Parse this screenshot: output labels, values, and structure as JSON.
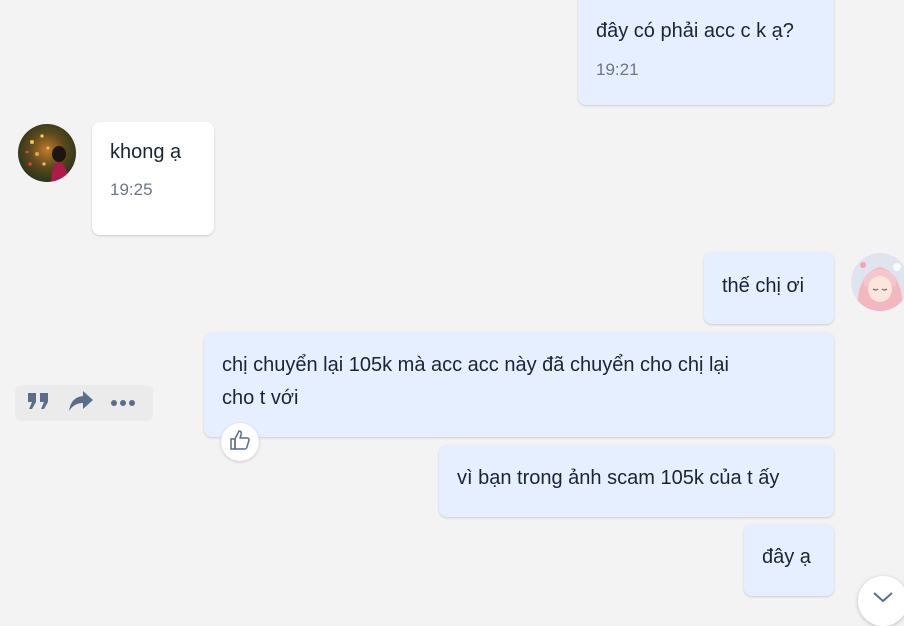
{
  "messages": [
    {
      "id": "m1",
      "direction": "outgoing",
      "text": "đây có phải acc c k ạ?",
      "time": "19:21"
    },
    {
      "id": "m2",
      "direction": "incoming",
      "text": "khong ạ",
      "time": "19:25"
    },
    {
      "id": "m3",
      "direction": "outgoing",
      "text": "thế chị ơi"
    },
    {
      "id": "m4",
      "direction": "outgoing",
      "text": "chị chuyển lại 105k mà acc acc này đã chuyển cho chị lại\ncho t với"
    },
    {
      "id": "m5",
      "direction": "outgoing",
      "text": "vì bạn trong ảnh scam 105k của t ấy"
    },
    {
      "id": "m6",
      "direction": "outgoing",
      "text": "đây ạ"
    }
  ],
  "hover_toolbar": {
    "icons": [
      "quote-icon",
      "share-icon",
      "more-options-icon"
    ]
  },
  "reaction": {
    "icon": "thumbs-up-icon"
  },
  "scroll_button": {
    "icon": "chevron-down-icon"
  },
  "colors": {
    "background": "#f3f3f3",
    "outgoing_bubble": "#e5efff",
    "incoming_bubble": "#ffffff",
    "text": "#1b2431",
    "time": "#6c7785",
    "icon": "#5a6e8a"
  }
}
